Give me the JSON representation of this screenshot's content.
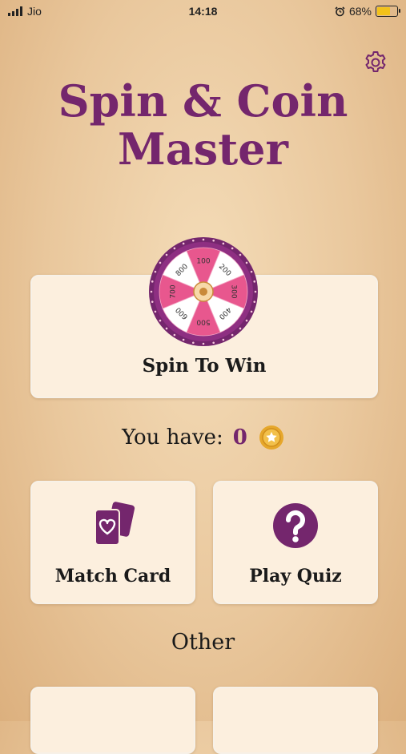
{
  "status_bar": {
    "carrier": "Jio",
    "time": "14:18",
    "battery_percent": "68%",
    "battery_level": 0.68
  },
  "app": {
    "title_line1": "Spin & Coin",
    "title_line2": "Master"
  },
  "spin": {
    "label": "Spin To Win",
    "wheel_values": [
      "100",
      "200",
      "300",
      "400",
      "500",
      "600",
      "700",
      "800"
    ]
  },
  "coins": {
    "prefix": "You have:",
    "count": "0"
  },
  "games": [
    {
      "label": "Match Card",
      "icon": "cards-heart-icon"
    },
    {
      "label": "Play Quiz",
      "icon": "question-icon"
    }
  ],
  "other": {
    "title": "Other"
  },
  "colors": {
    "brand": "#74266d",
    "card_bg": "#fcefde",
    "wheel_pink": "#e8578e",
    "coin_gold": "#e6a72b"
  }
}
